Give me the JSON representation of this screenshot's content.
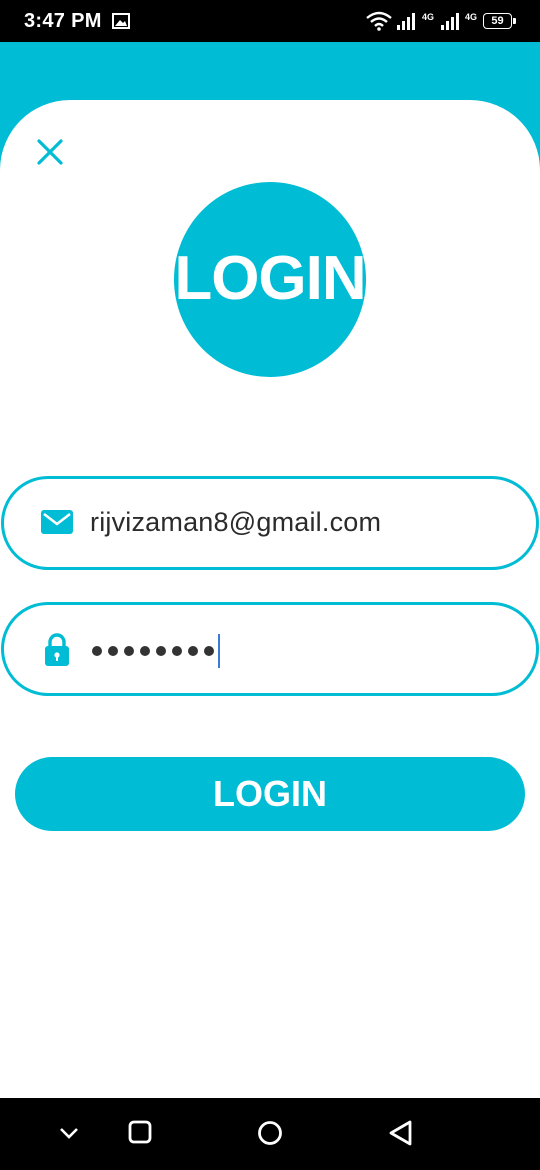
{
  "status_bar": {
    "time": "3:47 PM",
    "network_1": "4G",
    "network_2": "4G",
    "battery": "59",
    "icons": [
      "gallery-icon",
      "wifi-icon",
      "signal-icon",
      "signal-icon",
      "battery-icon"
    ]
  },
  "header": {
    "close_icon": "close-icon",
    "logo_text": "LOGIN"
  },
  "form": {
    "email": {
      "icon": "mail-icon",
      "value": "rijvizaman8@gmail.com"
    },
    "password": {
      "icon": "lock-icon",
      "masked_length": 8
    },
    "submit_label": "LOGIN"
  },
  "nav_bar": {
    "icons": [
      "chevron-down-icon",
      "recents-icon",
      "home-icon",
      "back-icon"
    ]
  },
  "colors": {
    "accent": "#00bcd4",
    "text": "#2b2b2b",
    "caret": "#3a7bd5",
    "system_bars": "#000000"
  }
}
